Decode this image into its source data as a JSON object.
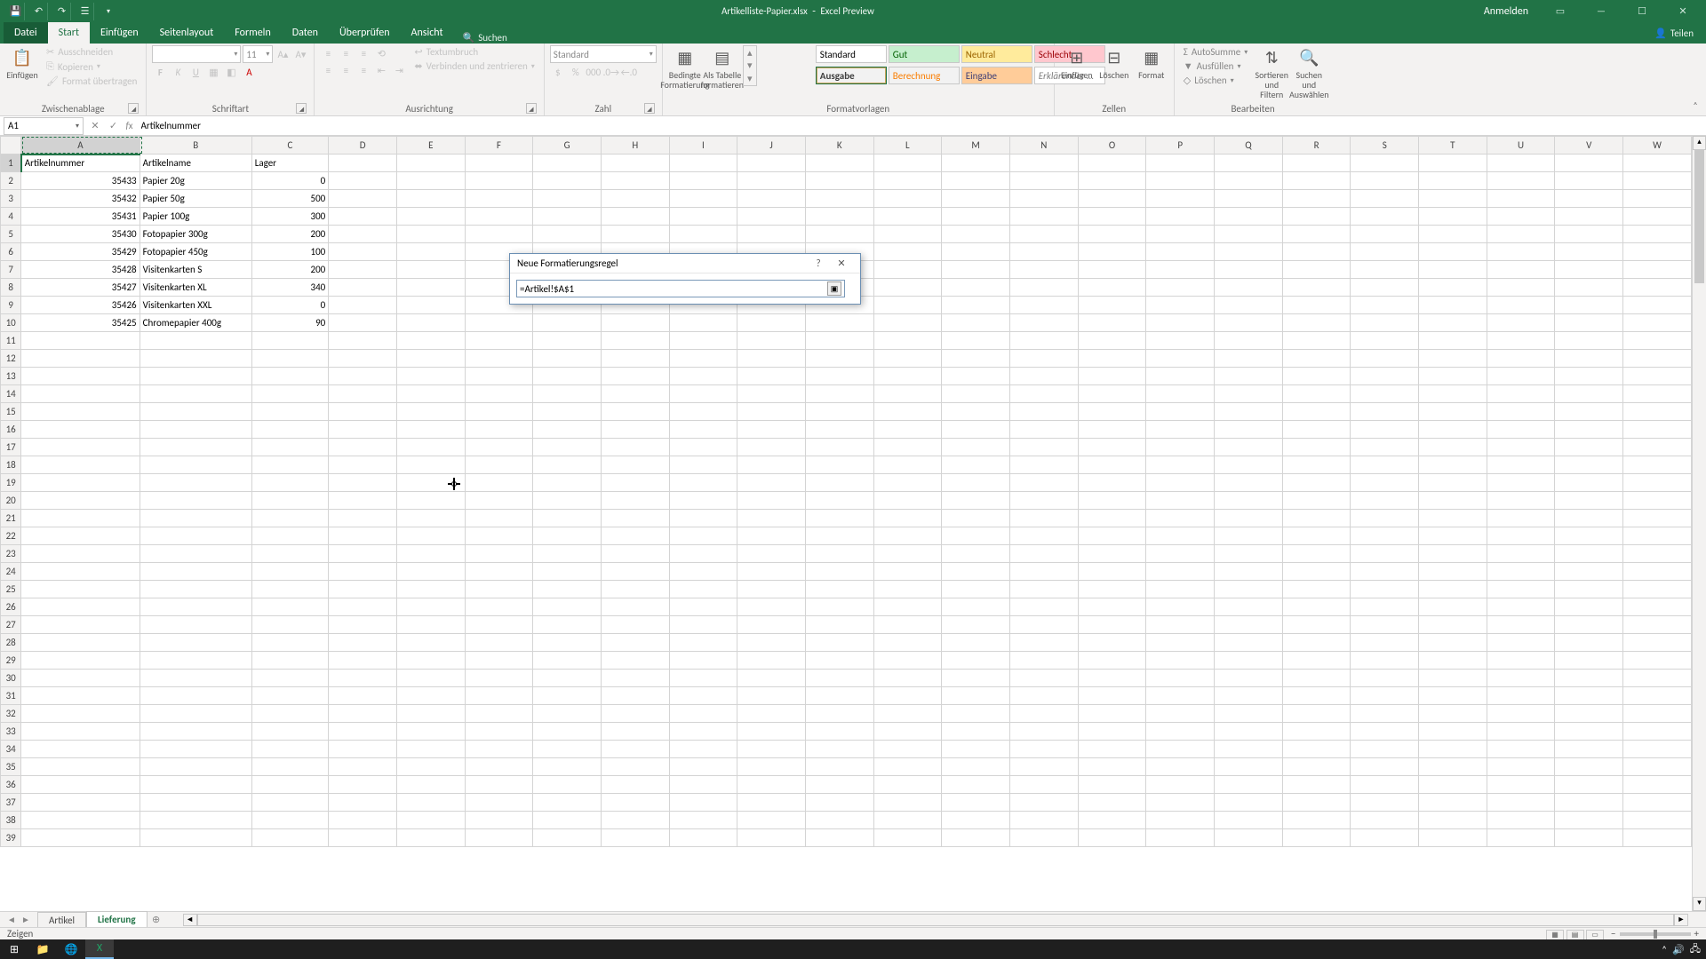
{
  "titlebar": {
    "filename": "Artikelliste-Papier.xlsx",
    "mode": "Excel Preview",
    "login": "Anmelden"
  },
  "tabs": {
    "file": "Datei",
    "list": [
      "Start",
      "Einfügen",
      "Seitenlayout",
      "Formeln",
      "Daten",
      "Überprüfen",
      "Ansicht"
    ],
    "search": "Suchen",
    "share": "Teilen"
  },
  "ribbon": {
    "clipboard": {
      "paste": "Einfügen",
      "cut": "Ausschneiden",
      "copy": "Kopieren",
      "painter": "Format übertragen",
      "group": "Zwischenablage"
    },
    "font": {
      "size": "11",
      "group": "Schriftart"
    },
    "align": {
      "wrap": "Textumbruch",
      "merge": "Verbinden und zentrieren",
      "group": "Ausrichtung"
    },
    "number": {
      "format": "Standard",
      "group": "Zahl"
    },
    "styles": {
      "cond": "Bedingte Formatierung",
      "table": "Als Tabelle formatieren",
      "cells": [
        "Standard",
        "Gut",
        "Neutral",
        "Schlecht",
        "Ausgabe",
        "Berechnung",
        "Eingabe",
        "Erklärender ..."
      ],
      "group": "Formatvorlagen"
    },
    "cells": {
      "insert": "Einfügen",
      "delete": "Löschen",
      "format": "Format",
      "group": "Zellen"
    },
    "editing": {
      "sum": "AutoSumme",
      "fill": "Ausfüllen",
      "clear": "Löschen",
      "sort": "Sortieren und Filtern",
      "find": "Suchen und Auswählen",
      "group": "Bearbeiten"
    }
  },
  "namebox": "A1",
  "formula": "Artikelnummer",
  "columns": [
    "A",
    "B",
    "C",
    "D",
    "E",
    "F",
    "G",
    "H",
    "I",
    "J",
    "K",
    "L",
    "M",
    "N",
    "O",
    "P",
    "Q",
    "R",
    "S",
    "T",
    "U",
    "V",
    "W"
  ],
  "rows": [
    {
      "r": 1,
      "a": "Artikelnummer",
      "b": "Artikelname",
      "c": "Lager"
    },
    {
      "r": 2,
      "a": "35433",
      "b": "Papier 20g",
      "c": "0"
    },
    {
      "r": 3,
      "a": "35432",
      "b": "Papier 50g",
      "c": "500"
    },
    {
      "r": 4,
      "a": "35431",
      "b": "Papier 100g",
      "c": "300"
    },
    {
      "r": 5,
      "a": "35430",
      "b": "Fotopapier 300g",
      "c": "200"
    },
    {
      "r": 6,
      "a": "35429",
      "b": "Fotopapier 450g",
      "c": "100"
    },
    {
      "r": 7,
      "a": "35428",
      "b": "Visitenkarten S",
      "c": "200"
    },
    {
      "r": 8,
      "a": "35427",
      "b": "Visitenkarten XL",
      "c": "340"
    },
    {
      "r": 9,
      "a": "35426",
      "b": "Visitenkarten XXL",
      "c": "0"
    },
    {
      "r": 10,
      "a": "35425",
      "b": "Chromepapier 400g",
      "c": "90"
    }
  ],
  "emptyrows": 29,
  "dialog": {
    "title": "Neue Formatierungsregel",
    "value": "=Artikel!$A$1"
  },
  "sheets": {
    "list": [
      "Artikel",
      "Lieferung"
    ],
    "active": 1
  },
  "status": {
    "mode": "Zeigen"
  }
}
